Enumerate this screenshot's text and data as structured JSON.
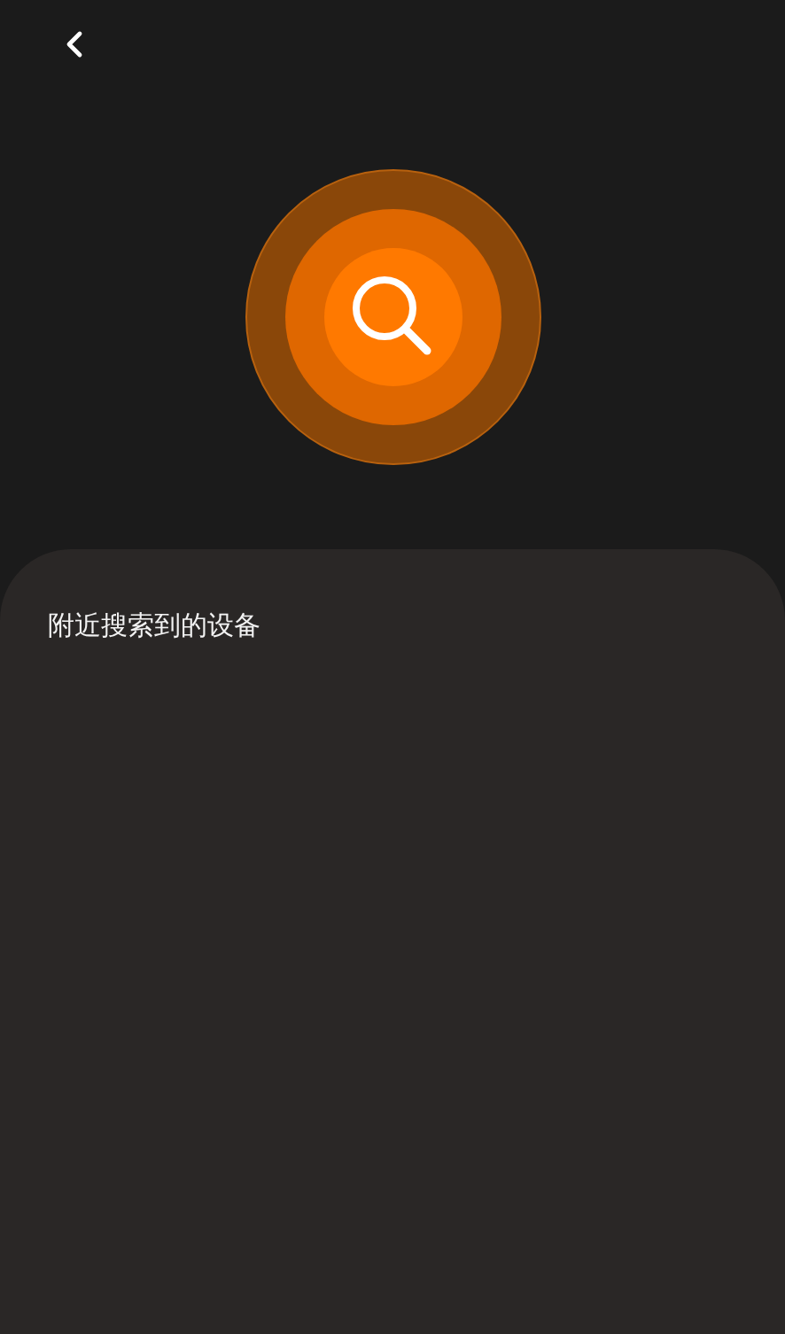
{
  "panel": {
    "title": "附近搜索到的设备"
  }
}
